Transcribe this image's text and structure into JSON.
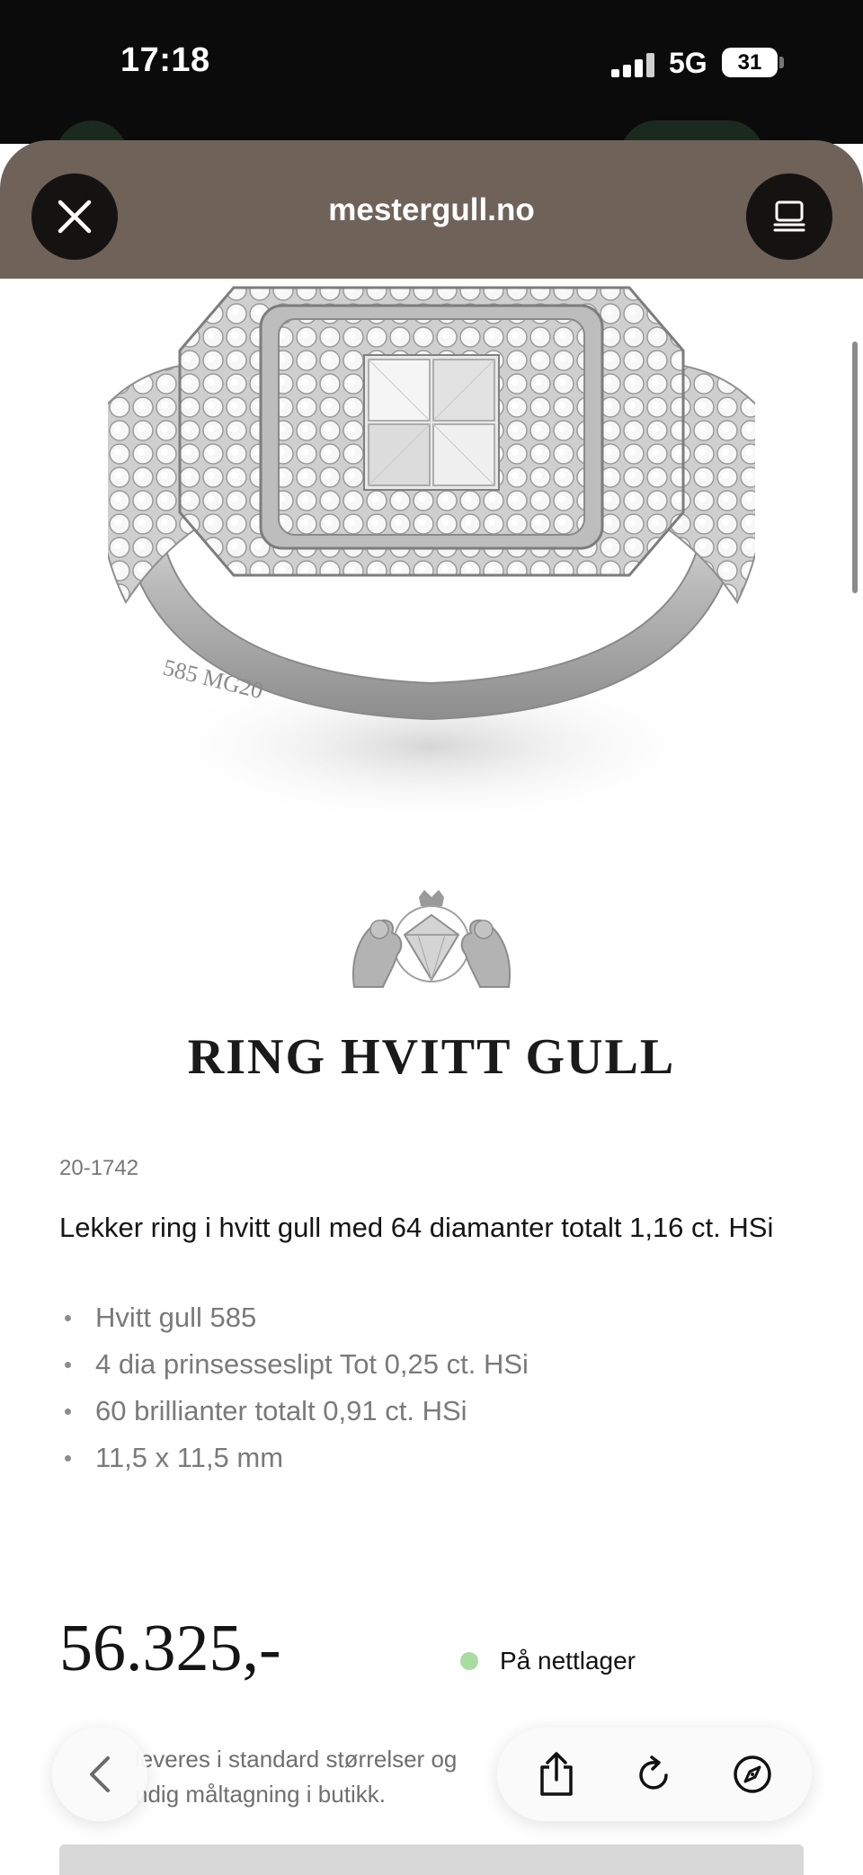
{
  "status_bar": {
    "time": "17:18",
    "network": "5G",
    "battery": "31"
  },
  "browser": {
    "url": "mestergull.no",
    "close_icon": "close-icon",
    "reader_icon": "reader-mode-icon"
  },
  "product": {
    "image_description_icon": "ring-photo",
    "brand_crest_icon": "crest-logo-icon",
    "title": "RING HVITT GULL",
    "sku": "20-1742",
    "description": "Lekker ring i hvitt gull med 64 diamanter totalt 1,16 ct. HSi",
    "specs": [
      "Hvitt gull 585",
      "4 dia prinsesseslipt Tot 0,25 ct. HSi",
      "60 brillianter totalt 0,91 ct. HSi",
      "11,5 x 11,5 mm"
    ],
    "price": "56.325,-",
    "stock_status": "På nettlager",
    "stock_color": "#a8dca0",
    "size_note_line1": "leveres i standard størrelser og",
    "size_note_line2": "ndig måltagning i butikk."
  },
  "toolbar": {
    "back_icon": "chevron-left-icon",
    "share_icon": "share-icon",
    "reload_icon": "reload-icon",
    "safari_icon": "compass-icon"
  },
  "colors": {
    "header_bg": "#6f6259",
    "button_bg": "#151312"
  }
}
